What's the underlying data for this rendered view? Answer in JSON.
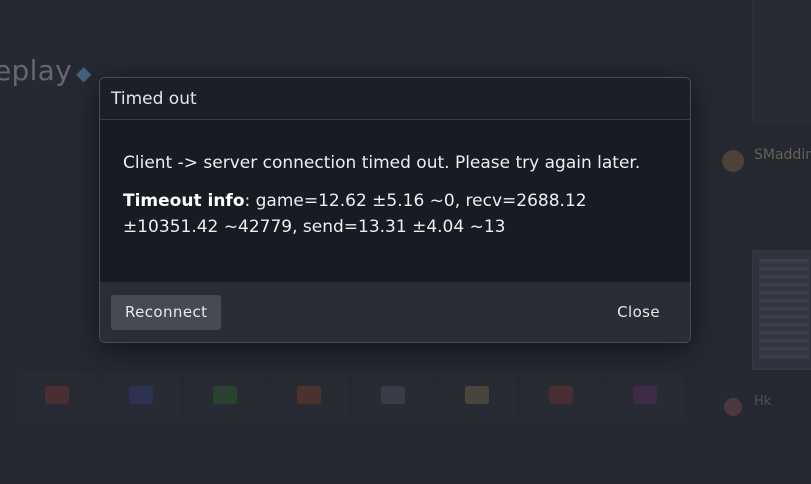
{
  "background": {
    "page_title_fragment": "eplay",
    "chat_entries": [
      {
        "user": "SMaddin",
        "lines": [
          "...",
          "...",
          "..."
        ]
      },
      {
        "user": "Hk",
        "lines": [
          "...",
          "...",
          "..."
        ]
      }
    ]
  },
  "dialog": {
    "title": "Timed out",
    "message": "Client -> server connection timed out. Please try again later.",
    "info_label": "Timeout info",
    "info_text": ": game=12.62 ±5.16 ~0, recv=2688.12 ±10351.42 ~42779, send=13.31 ±4.04 ~13",
    "reconnect_label": "Reconnect",
    "close_label": "Close"
  },
  "colors": {
    "dialog_bg": "#1b1d26",
    "footer_bg": "#2a2d35",
    "button_bg": "#474a52"
  }
}
